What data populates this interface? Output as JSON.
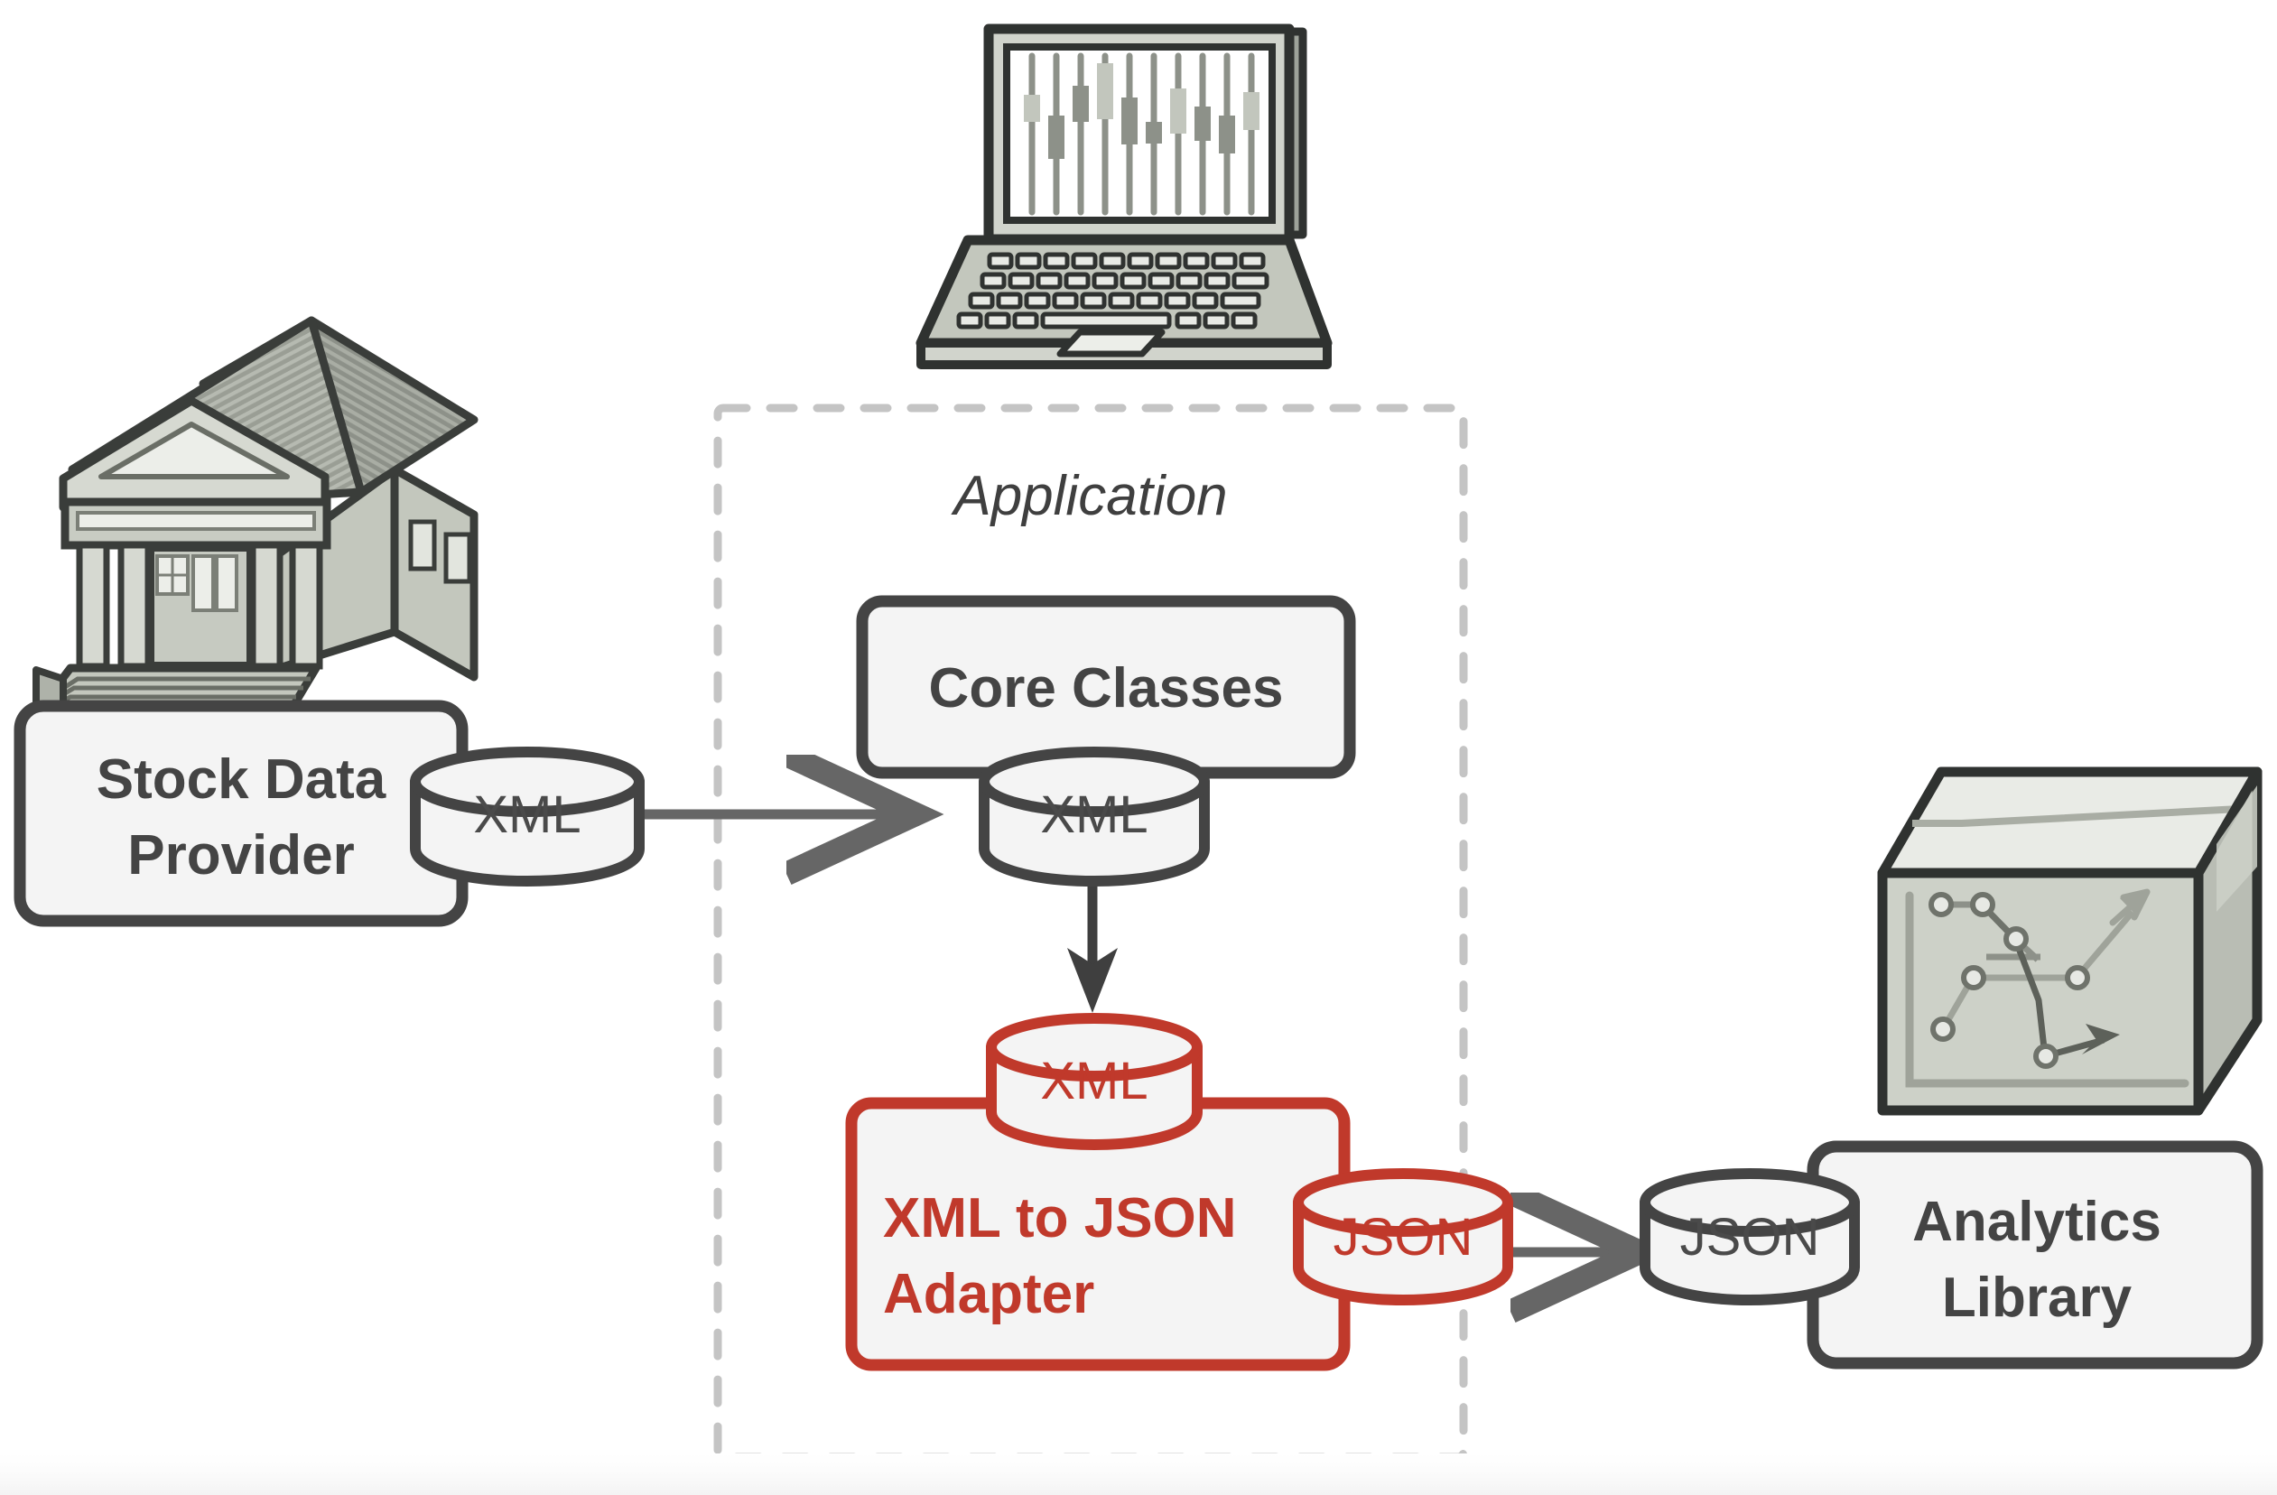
{
  "diagram": {
    "title_group": "Application",
    "colors": {
      "stroke_dark": "#444444",
      "accent_red": "#c0392b",
      "fill_light": "#f4f4f4",
      "dashed_gray": "#c4c4c4",
      "arrow_gray": "#666666",
      "icon_gray_light": "#d3d6cf",
      "icon_gray_mid": "#a8ada3",
      "icon_gray_dark": "#8c9189",
      "background": "#ffffff"
    },
    "nodes": [
      {
        "id": "stock-data-provider",
        "label": "Stock Data\nProvider",
        "line1": "Stock Data",
        "line2": "Provider",
        "style": "dark"
      },
      {
        "id": "core-classes",
        "label": "Core Classes",
        "line1": "Core Classes",
        "line2": "",
        "style": "dark"
      },
      {
        "id": "xml-to-json-adapter",
        "label": "XML to JSON\nAdapter",
        "line1": "XML to JSON",
        "line2": "Adapter",
        "style": "red"
      },
      {
        "id": "analytics-library",
        "label": "Analytics\nLibrary",
        "line1": "Analytics",
        "line2": "Library",
        "style": "dark"
      }
    ],
    "interfaces": [
      {
        "id": "provider-xml-out",
        "label": "XML",
        "style": "dark"
      },
      {
        "id": "core-xml-in",
        "label": "XML",
        "style": "dark"
      },
      {
        "id": "adapter-xml-in",
        "label": "XML",
        "style": "red"
      },
      {
        "id": "adapter-json-out",
        "label": "JSON",
        "style": "red"
      },
      {
        "id": "analytics-json-in",
        "label": "JSON",
        "style": "dark"
      }
    ],
    "connections": [
      {
        "from": "provider-xml-out",
        "to": "core-xml-in",
        "style": "arrow-gray"
      },
      {
        "from": "core-xml-in",
        "to": "adapter-xml-in",
        "style": "arrow-dark"
      },
      {
        "from": "adapter-json-out",
        "to": "analytics-json-in",
        "style": "arrow-gray"
      }
    ],
    "icons": [
      {
        "id": "bank-building-icon",
        "name": "bank-building-icon",
        "depicts": "classical bank building with columns and steps"
      },
      {
        "id": "laptop-chart-icon",
        "name": "laptop-candlestick-chart-icon",
        "depicts": "open laptop displaying a candlestick stock chart"
      },
      {
        "id": "package-box-icon",
        "name": "package-box-chart-icon",
        "depicts": "3D cardboard box with a line chart and trend arrows"
      }
    ]
  }
}
